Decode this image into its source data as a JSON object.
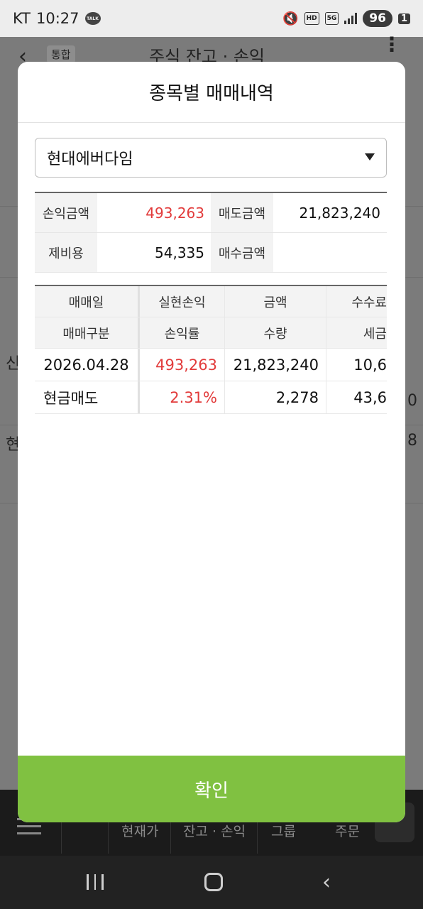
{
  "status_bar": {
    "carrier": "KT",
    "time": "10:27",
    "talk_badge": "TALK",
    "hd": "HD",
    "network": "5G",
    "battery": "96",
    "sim_slot": "1"
  },
  "background_app": {
    "tag": "통합",
    "title": "주식 잔고 · 손익",
    "side_left_1": "신",
    "side_left_2": "현",
    "side_right_1": "0",
    "side_right_2": "8",
    "bottom_nav": {
      "item1": "현재가",
      "item2": "잔고 · 손익",
      "item3": "그룹",
      "item4": "주문"
    }
  },
  "modal": {
    "title": "종목별 매매내역",
    "stock_select": "현대에버다임",
    "summary": [
      {
        "label": "손익금액",
        "value": "493,263",
        "label2": "매도금액",
        "value2": "21,823,240"
      },
      {
        "label": "제비용",
        "value": "54,335",
        "label2": "매수금액",
        "value2": ""
      }
    ],
    "table": {
      "headers_row1": [
        "매매일",
        "실현손익",
        "금액",
        "수수료"
      ],
      "headers_row2": [
        "매매구분",
        "손익률",
        "수량",
        "세금"
      ],
      "rows": [
        {
          "date": "2026.04.28",
          "realized_pl": "493,263",
          "amount": "21,823,240",
          "fee": "10,6"
        },
        {
          "type": "현금매도",
          "pl_rate": "2.31%",
          "quantity": "2,278",
          "tax": "43,6"
        }
      ]
    },
    "confirm_label": "확인"
  },
  "colors": {
    "accent": "#80c141",
    "profit": "#e23b3b"
  }
}
